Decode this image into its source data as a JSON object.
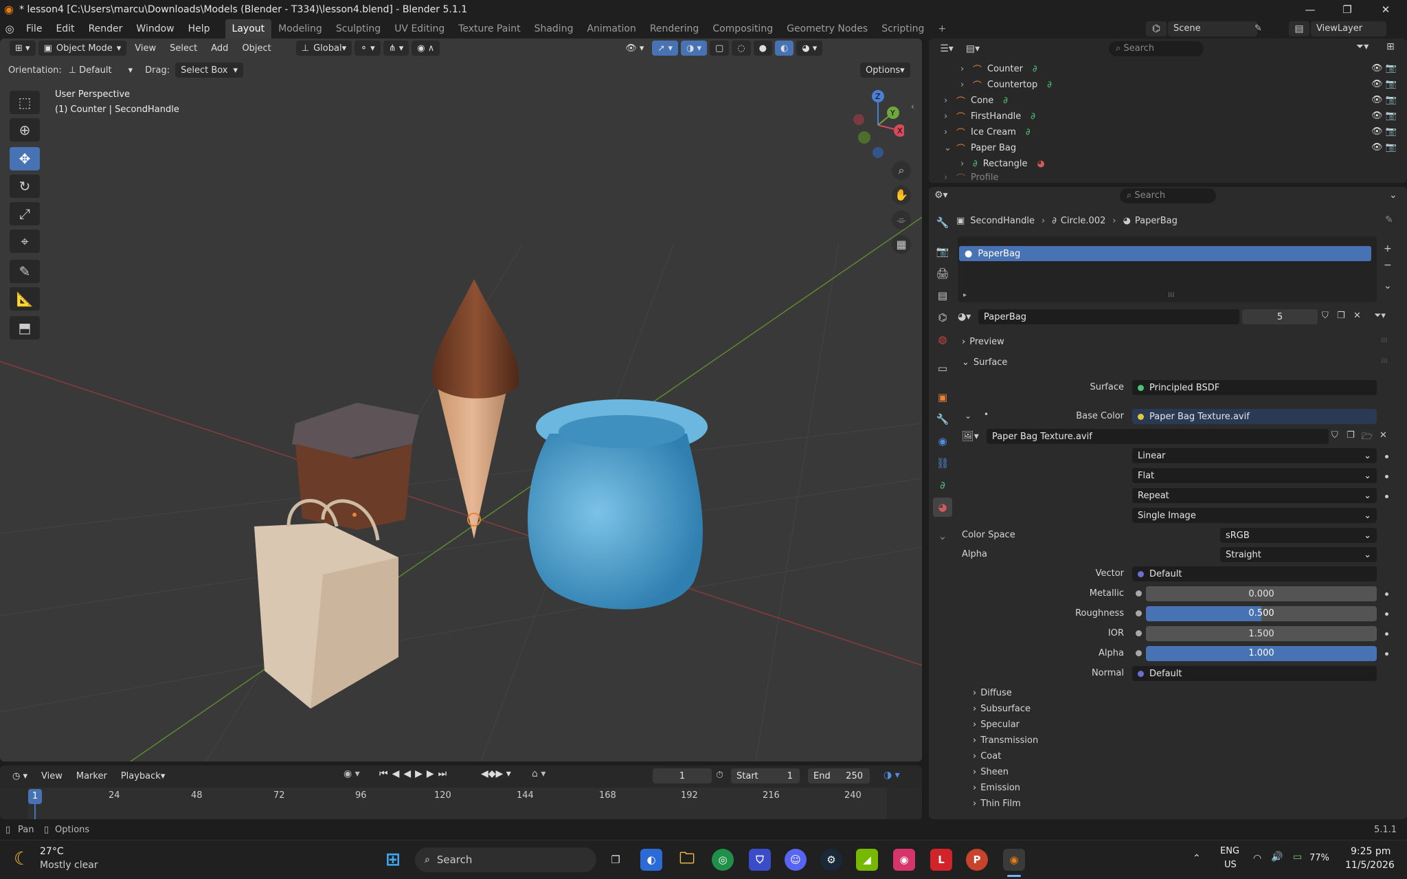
{
  "window": {
    "title": "* lesson4 [C:\\Users\\marcu\\Downloads\\Models (Blender - T334)\\lesson4.blend] - Blender 5.1.1",
    "min": "—",
    "max": "❐",
    "close": "✕"
  },
  "menu": [
    "File",
    "Edit",
    "Render",
    "Window",
    "Help"
  ],
  "workspaces": [
    "Layout",
    "Modeling",
    "Sculpting",
    "UV Editing",
    "Texture Paint",
    "Shading",
    "Animation",
    "Rendering",
    "Compositing",
    "Geometry Nodes",
    "Scripting",
    "+"
  ],
  "scene": {
    "name": "Scene",
    "view_layer": "ViewLayer"
  },
  "viewport": {
    "mode": "Object Mode",
    "header_menus": [
      "View",
      "Select",
      "Add",
      "Object"
    ],
    "transform": "Global",
    "orientation_label": "Orientation:",
    "orientation": "Default",
    "drag_label": "Drag:",
    "drag": "Select Box",
    "options": "Options",
    "view_name": "User Perspective",
    "context": "(1) Counter | SecondHandle",
    "gizmo_labels": {
      "x": "X",
      "y": "Y",
      "z": "Z"
    }
  },
  "outliner": {
    "search_placeholder": "Search",
    "rows": [
      {
        "name": "Counter",
        "indent": 1
      },
      {
        "name": "Countertop",
        "indent": 1
      },
      {
        "name": "Cone",
        "indent": 0
      },
      {
        "name": "FirstHandle",
        "indent": 0
      },
      {
        "name": "Ice Cream",
        "indent": 0
      },
      {
        "name": "Paper Bag",
        "indent": 0
      },
      {
        "name": "Rectangle",
        "indent": 1
      },
      {
        "name": "Profile",
        "indent": 0
      }
    ]
  },
  "properties": {
    "search_placeholder": "Search",
    "breadcrumb": [
      "SecondHandle",
      "Circle.002",
      "PaperBag"
    ],
    "slot": "PaperBag",
    "material_name": "PaperBag",
    "users": "5",
    "preview": "Preview",
    "surface_panel": "Surface",
    "surface_label": "Surface",
    "surface_value": "Principled BSDF",
    "base_color_label": "Base Color",
    "base_color_value": "Paper Bag Texture.avif",
    "image_name": "Paper Bag Texture.avif",
    "interpolation": "Linear",
    "projection": "Flat",
    "extension": "Repeat",
    "source": "Single Image",
    "color_space_label": "Color Space",
    "color_space": "sRGB",
    "alpha_mode_label": "Alpha",
    "alpha_mode": "Straight",
    "vector_label": "Vector",
    "vector_value": "Default",
    "metallic_label": "Metallic",
    "metallic": "0.000",
    "roughness_label": "Roughness",
    "roughness": "0.500",
    "roughness_fraction": 0.5,
    "ior_label": "IOR",
    "ior": "1.500",
    "alpha_label": "Alpha",
    "alpha": "1.000",
    "alpha_fraction": 1.0,
    "normal_label": "Normal",
    "normal_value": "Default",
    "subpanels": [
      "Diffuse",
      "Subsurface",
      "Specular",
      "Transmission",
      "Coat",
      "Sheen",
      "Emission",
      "Thin Film"
    ]
  },
  "timeline": {
    "menus": [
      "View",
      "Marker",
      "Playback"
    ],
    "current_frame": "1",
    "start_label": "Start",
    "start": "1",
    "end_label": "End",
    "end": "250",
    "ticks": [
      "24",
      "48",
      "72",
      "96",
      "120",
      "144",
      "168",
      "192",
      "216",
      "240"
    ],
    "playhead": "1"
  },
  "status": {
    "pan": "Pan",
    "options": "Options",
    "version": "5.1.1"
  },
  "taskbar": {
    "weather_temp": "27°C",
    "weather_desc": "Mostly clear",
    "search": "Search",
    "lang": "ENG",
    "region": "US",
    "battery": "77%",
    "time": "9:25 pm",
    "date": "11/5/2026"
  },
  "colors": {
    "accent": "#4772b3",
    "active_object": "#e8833a",
    "object_green": "#4fc27a",
    "dot_yellow": "#e3c83b",
    "dot_purple": "#6d6dd6"
  }
}
